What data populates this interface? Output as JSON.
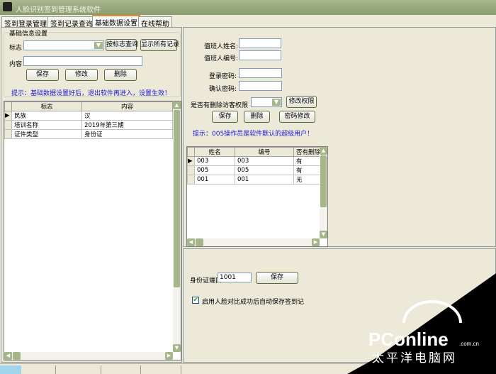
{
  "window": {
    "title": "人脸识别签到管理系统软件",
    "icon": "camera-icon"
  },
  "tabs": [
    {
      "label": "签到登录管理"
    },
    {
      "label": "签到记录查询"
    },
    {
      "label": "基础数据设置",
      "active": true
    },
    {
      "label": "在线帮助"
    }
  ],
  "basic": {
    "group_title": "基础信息设置",
    "flag_label": "标志",
    "flag_value": "",
    "query_button": "按标志查询",
    "show_all_button": "显示所有记录",
    "content_label": "内容",
    "content_value": "",
    "save_button": "保存",
    "edit_button": "修改",
    "delete_button": "删除",
    "hint": "提示：基础数据设置好后，退出软件再进入，设置生效！",
    "grid": {
      "columns": [
        "标志",
        "内容"
      ],
      "rows": [
        [
          "民族",
          "汉"
        ],
        [
          "培训名称",
          "2019年第三期"
        ],
        [
          "证件类型",
          "身份证"
        ]
      ]
    }
  },
  "operator": {
    "name_label": "值班人姓名:",
    "name_value": "",
    "id_label": "值班人编号:",
    "id_value": "",
    "password_label": "登录密码:",
    "confirm_label": "确认密码:",
    "permission_label": "是否有删除访客权限",
    "permission_value": "",
    "change_permission_button": "修改权限",
    "save_button": "保存",
    "delete_button": "删除",
    "change_password_button": "密码修改",
    "hint": "提示：005操作员是软件默认的超级用户！",
    "grid": {
      "columns": [
        "姓名",
        "编号",
        "否有删除权"
      ],
      "rows": [
        [
          "003",
          "003",
          "有"
        ],
        [
          "005",
          "005",
          "有"
        ],
        [
          "001",
          "001",
          "无"
        ]
      ]
    }
  },
  "idcard": {
    "port_label": "身份证端口",
    "port_value": "1001",
    "save_button": "保存",
    "auto_save_label": "启用人脸对比成功后自动保存签到记",
    "auto_save_checked": true
  },
  "watermark": {
    "logo": "PConline",
    "domain": ".com.cn",
    "subtitle": "太平洋电脑网"
  },
  "colors": {
    "hint": "#1a1ad6",
    "accent": "#a4b68a",
    "tab_active": "#e68b2c"
  }
}
